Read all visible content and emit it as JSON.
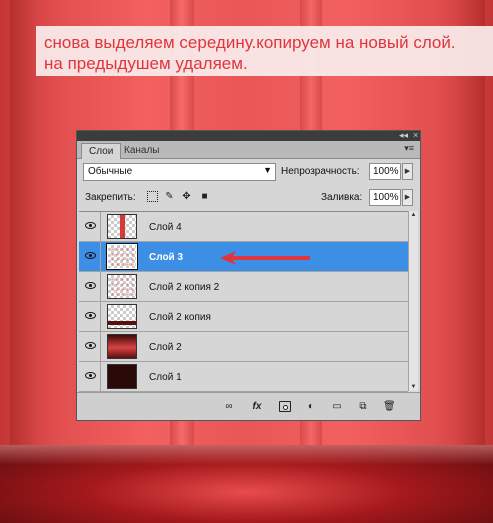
{
  "annotation": {
    "line1": "снова выделяем середину.копируем на новый слой.",
    "line2": "на предыдушем удаляем.",
    "color": "#e0353d"
  },
  "panel": {
    "collapse_icon": "double-chevron-left-icon",
    "close_icon": "close-icon",
    "tabs": [
      {
        "label": "Слои",
        "active": true
      },
      {
        "label": "Каналы",
        "active": false
      }
    ],
    "menu_icon": "panel-menu-icon",
    "blend_mode": "Обычные",
    "opacity_label": "Непрозрачность:",
    "opacity_value": "100%",
    "lock_label": "Закрепить:",
    "lock_icons": [
      "lock-transparency-icon",
      "lock-paint-icon",
      "lock-position-icon",
      "lock-all-icon"
    ],
    "fill_label": "Заливка:",
    "fill_value": "100%",
    "layers": [
      {
        "name": "Слой 4",
        "thumb": "red-strip",
        "selected": false
      },
      {
        "name": "Слой 3",
        "thumb": "dots",
        "selected": true
      },
      {
        "name": "Слой 2 копия 2",
        "thumb": "dots",
        "selected": false
      },
      {
        "name": "Слой 2 копия",
        "thumb": "dark-line",
        "selected": false
      },
      {
        "name": "Слой 2",
        "thumb": "solid-red",
        "selected": false
      },
      {
        "name": "Слой 1",
        "thumb": "solid-dark",
        "selected": false
      }
    ],
    "footer_icons": [
      "link-layers-icon",
      "fx-icon",
      "layer-mask-icon",
      "adjustment-layer-icon",
      "new-group-icon",
      "new-layer-icon",
      "trash-icon"
    ],
    "fx_label": "fx",
    "selection_color": "#3d8fe6",
    "arrow_color": "#e0353d"
  }
}
